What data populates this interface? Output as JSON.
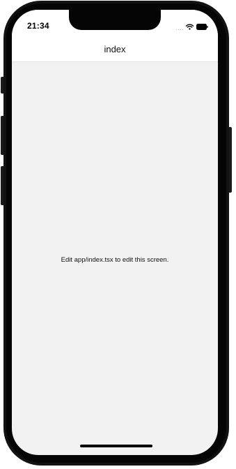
{
  "status_bar": {
    "time": "21:34",
    "icons": [
      "signal-dots-icon",
      "wifi-icon",
      "battery-icon"
    ]
  },
  "header": {
    "title": "index"
  },
  "main": {
    "message": "Edit app/index.tsx to edit this screen."
  },
  "colors": {
    "screen_background": "#f2f2f2",
    "header_background": "#ffffff",
    "frame": "#121212"
  }
}
